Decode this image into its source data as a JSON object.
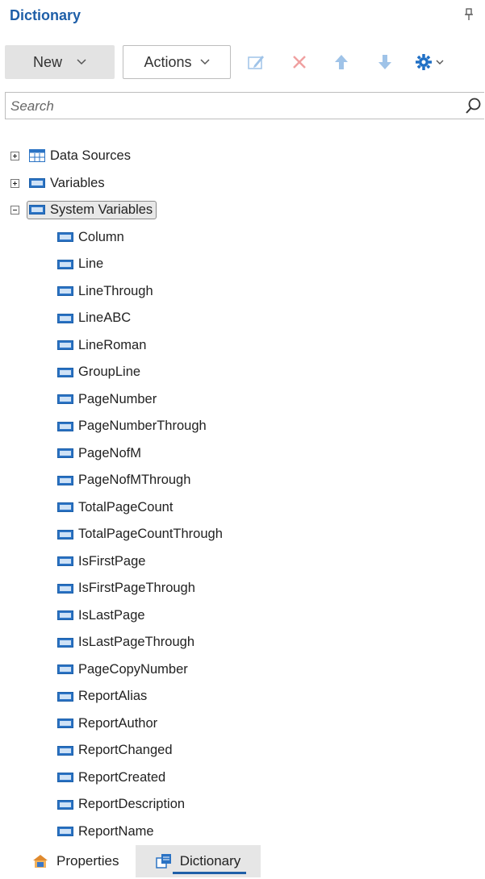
{
  "header": {
    "title": "Dictionary",
    "pin_glyph": "ц"
  },
  "toolbar": {
    "new_label": "New",
    "actions_label": "Actions",
    "icons": [
      "edit-icon",
      "delete-icon",
      "move-up-icon",
      "move-down-icon",
      "settings-icon"
    ],
    "accent": "#1f6fc5",
    "delete_color": "#e34b4b"
  },
  "search": {
    "placeholder": "Search",
    "value": ""
  },
  "tree": {
    "roots": [
      {
        "label": "Data Sources",
        "expanded": false
      },
      {
        "label": "Variables",
        "expanded": false
      },
      {
        "label": "System Variables",
        "expanded": true,
        "selected": true
      }
    ],
    "system_variables": [
      "Column",
      "Line",
      "LineThrough",
      "LineABC",
      "LineRoman",
      "GroupLine",
      "PageNumber",
      "PageNumberThrough",
      "PageNofM",
      "PageNofMThrough",
      "TotalPageCount",
      "TotalPageCountThrough",
      "IsFirstPage",
      "IsFirstPageThrough",
      "IsLastPage",
      "IsLastPageThrough",
      "PageCopyNumber",
      "ReportAlias",
      "ReportAuthor",
      "ReportChanged",
      "ReportCreated",
      "ReportDescription",
      "ReportName"
    ]
  },
  "bottom_tabs": {
    "properties": "Properties",
    "dictionary": "Dictionary",
    "active": "dictionary"
  }
}
